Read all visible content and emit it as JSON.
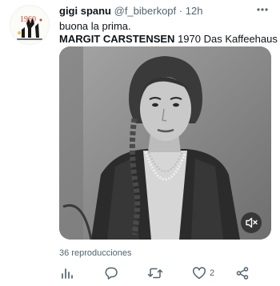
{
  "tweet": {
    "author_name": "gigi spanu",
    "author_handle": "@f_biberkopf",
    "separator": "·",
    "time": "12h",
    "text_line1": "buona la prima.",
    "text_bold": "MARGIT CARSTENSEN",
    "text_rest": " 1970 Das Kaffeehaus",
    "avatar_text": "1960",
    "views": "36 reproducciones",
    "like_count": "2"
  },
  "icons": {
    "more": "more-horizontal-icon",
    "mute": "volume-muted-icon",
    "analytics": "bar-chart-icon",
    "reply": "reply-icon",
    "retweet": "retweet-icon",
    "like": "heart-icon",
    "share": "share-icon"
  },
  "colors": {
    "secondary_text": "#536471",
    "avatar_red": "#d4432b",
    "avatar_yellow": "#f2c14e"
  }
}
